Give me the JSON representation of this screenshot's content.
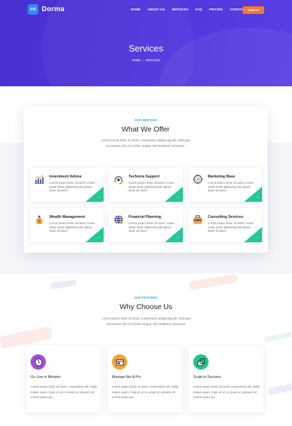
{
  "brand": {
    "name": "Dorma",
    "logo_glyph": "co"
  },
  "nav": [
    "HOME",
    "ABOUT US",
    "SERVICES",
    "FAQ",
    "PRICING",
    "CONTACT"
  ],
  "signin_label": "SIGN IN",
  "hero": {
    "title": "Services",
    "breadcrumb": [
      "HOME",
      "SERVICES"
    ]
  },
  "services": {
    "eyebrow": "OUR SERVICES",
    "title": "What We Offer",
    "desc_line1": "Lorem ipsum dolor sit amet, consectetur adipiscing elit. Sed quis",
    "desc_line2": "accumsan nisi Ut ut felis congue nisl hendrerit commodo.",
    "items": [
      {
        "title": "Investment Advise",
        "desc": "Lorem ipsum dolor sit amet, conse ctetur dolor adipiscing elit ipsum dolor sit amet.",
        "icon": "chart-icon"
      },
      {
        "title": "Technica Support",
        "desc": "Lorem ipsum dolor sit amet, conse ctetur dolor adipiscing elit ipsum dolor sit amet.",
        "icon": "headset-icon"
      },
      {
        "title": "Marketing Base",
        "desc": "Lorem ipsum dolor sit amet, conse ctetur dolor adipiscing elit ipsum dolor sit amet.",
        "icon": "target-icon"
      },
      {
        "title": "Wealth Management",
        "desc": "Lorem ipsum dolor sit amet, conse ctetur dolor adipiscing elit ipsum dolor sit amet.",
        "icon": "money-bag-icon"
      },
      {
        "title": "Financial Planning",
        "desc": "Lorem ipsum dolor sit amet, conse ctetur dolor adipiscing elit ipsum dolor sit amet.",
        "icon": "globe-icon"
      },
      {
        "title": "Consulting Services",
        "desc": "Lorem ipsum dolor sit amet, conse ctetur dolor adipiscing elit ipsum dolor sit amet.",
        "icon": "briefcase-icon"
      }
    ]
  },
  "features": {
    "eyebrow": "OUR FEATURES",
    "title": "Why Choose Us",
    "desc_line1": "Lorem ipsum dolor sit amet, consectetur adipiscing elit. Sed quis",
    "desc_line2": "accumsan nisi Ut ut felis congue nisl hendrerit commodo.",
    "items": [
      {
        "title": "Go Live in Minutes",
        "desc": "Lorem ipsum dolor sit amet, consectetur elit. Nulla neque quam, maxi ut ac cu msan ut, posuere sit Lorem ipsum qu.",
        "color": "#a24ed6",
        "icon": "clock-icon"
      },
      {
        "title": "Manage like A Pro",
        "desc": "Lorem ipsum dolor sit amet, consectetur elit. Nulla neque quam, maxi ut ac cu msan ut, posuere sit Lorem ipsum qu.",
        "color": "#f4a23a",
        "icon": "window-icon"
      },
      {
        "title": "Scale to Success",
        "desc": "Lorem ipsum dolor sit amet, consectetur elit. Nulla neque quam, maxi ut ac cu msan ut, posuere sit Lorem ipsum qu.",
        "color": "#20c48c",
        "icon": "scale-icon"
      }
    ]
  },
  "colors": {
    "hero": "#4e34da",
    "accent_green": "#22c79a",
    "eyebrow": "#2ba6e6",
    "signin": "#f47a2a"
  }
}
